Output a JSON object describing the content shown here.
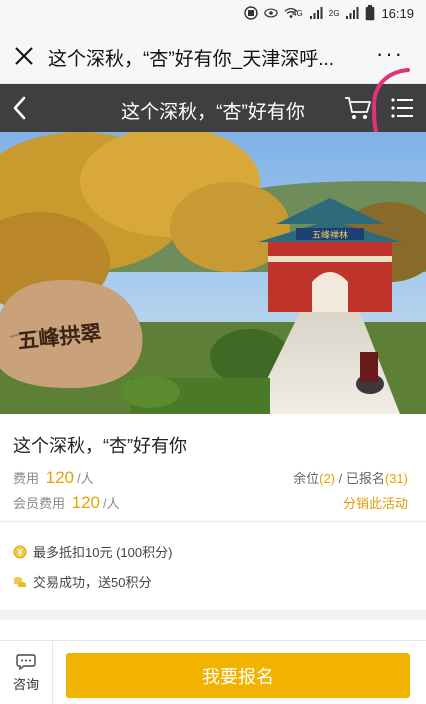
{
  "status_bar": {
    "network_a": "4G",
    "network_b": "2G",
    "battery_level": 1.0,
    "time": "16:19",
    "icons": [
      "hd-icon",
      "eye-icon",
      "wifi-icon",
      "signal-icon",
      "signal-icon",
      "battery-icon"
    ]
  },
  "wechat": {
    "page_title": "这个深秋，“杏”好有你_天津深呼...",
    "more_label": "···"
  },
  "nav": {
    "title": "这个深秋，“杏”好有你",
    "icons": [
      "back-icon",
      "cart-icon",
      "menu-icon"
    ]
  },
  "hero": {
    "stone_inscription": "五峰拱翠",
    "plaque_text": "五峰禅林"
  },
  "event": {
    "title": "这个深秋，“杏”好有你",
    "fee_label": "费用",
    "fee_value": "120",
    "fee_unit": "/人",
    "member_fee_label": "会员费用",
    "member_fee_value": "120",
    "member_fee_unit": "/人",
    "remaining_label": "余位",
    "remaining_value": "(2)",
    "separator": " / ",
    "signed_label": "已报名",
    "signed_value": "(31)",
    "share_label": "分销此活动"
  },
  "perks": [
    {
      "icon": "coin-icon",
      "text": "最多抵扣10元 (100积分)"
    },
    {
      "icon": "coins-stack-icon",
      "text": "交易成功，送50积分"
    }
  ],
  "bottom": {
    "consult_label": "咨询",
    "signup_label": "我要报名"
  },
  "colors": {
    "accent": "#f2b200",
    "price": "#e6a400",
    "nav_bg": "#3f3f3f",
    "annotation": "#e0337a"
  }
}
